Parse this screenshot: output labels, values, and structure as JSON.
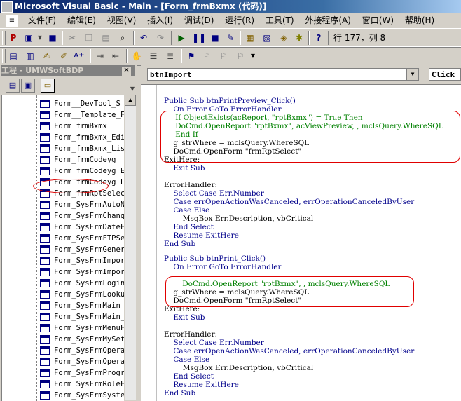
{
  "window": {
    "title": "Microsoft Visual Basic - Main - [Form_frmBxmx (代码)]"
  },
  "menu": [
    "文件(F)",
    "编辑(E)",
    "视图(V)",
    "插入(I)",
    "调试(D)",
    "运行(R)",
    "工具(T)",
    "外接程序(A)",
    "窗口(W)",
    "帮助(H)"
  ],
  "toolbar": {
    "position": "行 177，列 8"
  },
  "project": {
    "title": "工程 - UMWSoftBDP",
    "items": [
      "Form__DevTool_S",
      "Form__Template_F",
      "Form_frmBxmx",
      "Form_frmBxmx_Edi",
      "Form_frmBxmx_Lis",
      "Form_frmCodeyg",
      "Form_frmCodeyg_E",
      "Form_frmCodeyg_L",
      "Form_frmRptSelec",
      "Form_SysFrmAutoN",
      "Form_SysFrmChang",
      "Form_SysFrmDateF",
      "Form_SysFrmFTPSe",
      "Form_SysFrmGener",
      "Form_SysFrmImpor",
      "Form_SysFrmImpor",
      "Form_SysFrmLogin",
      "Form_SysFrmLooku",
      "Form_SysFrmMain",
      "Form_SysFrmMain_",
      "Form_SysFrmMenuF",
      "Form_SysFrmMySet",
      "Form_SysFrmOpera",
      "Form_SysFrmOpera",
      "Form_SysFrmProgr",
      "Form_SysFrmRoleF",
      "Form_SysFrmSyste"
    ]
  },
  "code": {
    "object": "btnImport",
    "procedure": "Click",
    "lines": [
      "Public Sub btnPrintPreview_Click()",
      "    On Error GoTo ErrorHandler",
      "'    If ObjectExists(acReport, \"rptBxmx\") = True Then",
      "'    DoCmd.OpenReport \"rptBxmx\", acViewPreview, , mclsQuery.WhereSQL",
      "'    End If",
      "    g_strWhere = mclsQuery.WhereSQL",
      "    DoCmd.OpenForm \"frmRptSelect\"",
      "ExitHere:",
      "    Exit Sub",
      "",
      "ErrorHandler:",
      "    Select Case Err.Number",
      "    Case errOpenActionWasCanceled, errOperationCanceledByUser",
      "    Case Else",
      "        MsgBox Err.Description, vbCritical",
      "    End Select",
      "    Resume ExitHere",
      "End Sub",
      "Public Sub btnPrint_Click()",
      "    On Error GoTo ErrorHandler",
      "",
      "'       DoCmd.OpenReport \"rptBxmx\", , mclsQuery.WhereSQL",
      "    g_strWhere = mclsQuery.WhereSQL",
      "    DoCmd.OpenForm \"frmRptSelect\"",
      "ExitHere:",
      "    Exit Sub",
      "",
      "ErrorHandler:",
      "    Select Case Err.Number",
      "    Case errOpenActionWasCanceled, errOperationCanceledByUser",
      "    Case Else",
      "        MsgBox Err.Description, vbCritical",
      "    End Select",
      "    Resume ExitHere",
      "End Sub"
    ]
  }
}
